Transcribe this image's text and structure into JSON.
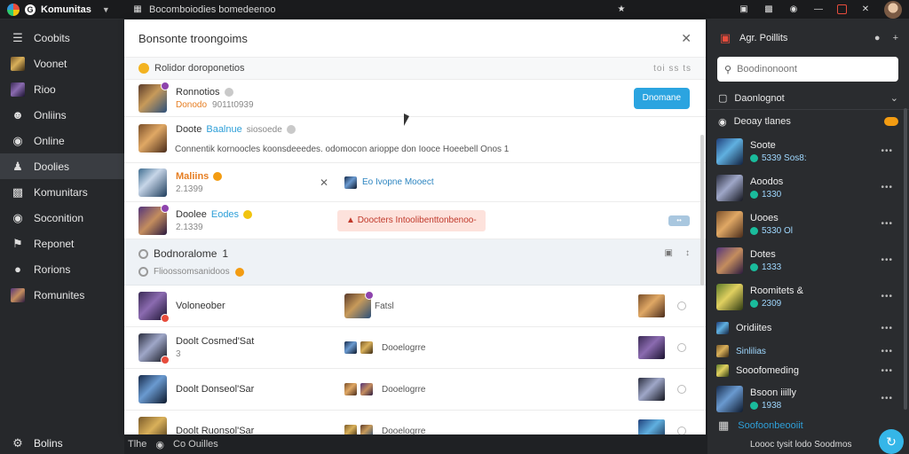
{
  "topbar": {
    "app_name": "Komunitas",
    "url_text": "Bocomboiodies bomedeenoo"
  },
  "leftnav": {
    "items": [
      {
        "label": "Coobits",
        "icon": "list-icon"
      },
      {
        "label": "Voonet",
        "icon": "game-thumb"
      },
      {
        "label": "Rioo",
        "icon": "game-thumb"
      },
      {
        "label": "Onliins",
        "icon": "users-icon"
      },
      {
        "label": "Online",
        "icon": "globe-icon"
      },
      {
        "label": "Doolies",
        "icon": "people-icon",
        "active": true
      },
      {
        "label": "Komunitars",
        "icon": "community-icon"
      },
      {
        "label": "Soconition",
        "icon": "chat-icon"
      },
      {
        "label": "Reponet",
        "icon": "flag-icon"
      },
      {
        "label": "Rorions",
        "icon": "group-icon"
      },
      {
        "label": "Romunites",
        "icon": "game-thumb"
      }
    ],
    "footer_label": "Bolins"
  },
  "modal": {
    "title": "Bonsonte troongoims",
    "subheader": {
      "text": "Rolidor doroponetios",
      "meta": "toi ss ts"
    },
    "rows": [
      {
        "name": "Ronnotios",
        "sub1": "Donodo",
        "sub2": "9011t0939",
        "button": "Dnomane"
      },
      {
        "name": "Doote",
        "name_accent": "Baalnue",
        "name_rest": "siosoede",
        "desc": "Connentik kornoocles koonsdeeedes. odomocon arioppe don Iooce Hoeebell Onos 1"
      },
      {
        "name": "Maliins",
        "sub1": "2.1399",
        "linked": "Eo Ivopne Mooect"
      },
      {
        "name": "Doolee",
        "name_accent": "Eodes",
        "sub1": "2.1339",
        "warning": "Doocters Intoolibenttonbenoo-",
        "mini_btn": "••"
      }
    ],
    "section": {
      "title": "Bodnoralome",
      "title_count": "1",
      "sub": "Flioossomsanidoos"
    },
    "grid_rows": [
      {
        "col1": "Voloneober",
        "col2": "Fatsl"
      },
      {
        "col1": "Doolt Cosmed'Sat",
        "col1_sub": "3",
        "col2": "Dooelogrre"
      },
      {
        "col1": "Doolt Donseol'Sar",
        "col2": "Dooelogrre"
      },
      {
        "col1": "Doolt Ruonsol'Sar",
        "col2": "Dooelogrre"
      }
    ],
    "footer": {
      "left": "Tlhe",
      "mid": "Co Ouilles"
    }
  },
  "rightpanel": {
    "title": "Agr. Poillits",
    "search_placeholder": "Boodinonoont",
    "section_label": "Daonlognot",
    "section2_label": "Deoay tlanes",
    "items": [
      {
        "name": "Soote",
        "meta": "5339 Sos8:"
      },
      {
        "name": "Aoodos",
        "meta": "1330"
      },
      {
        "name": "Uooes",
        "meta": "5330 Ol"
      },
      {
        "name": "Dotes",
        "meta": "1333"
      },
      {
        "name": "Roomitets &",
        "meta": "2309"
      },
      {
        "name": "Oridiites",
        "meta": "Sinlilias"
      },
      {
        "name": "Sooofomeding",
        "meta": ""
      },
      {
        "name": "Bsoon iiilly",
        "meta": "1938"
      }
    ],
    "footer_label": "Soofoonbeooiit",
    "footer_right": "Loooc tysit lodo   Soodmos"
  },
  "colors": {
    "accent": "#2ba4e0",
    "warning_bg": "#fde2dc",
    "panel": "#2a2c2f"
  }
}
